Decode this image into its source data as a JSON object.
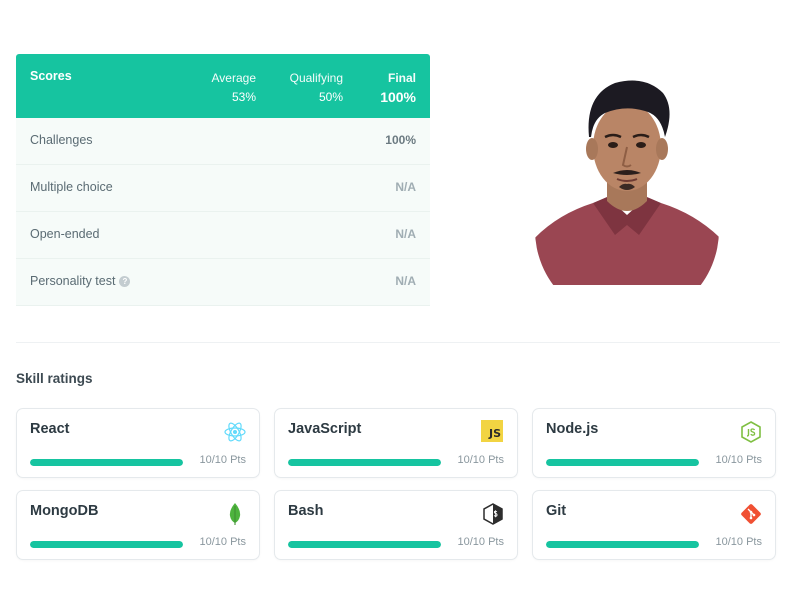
{
  "scores": {
    "title": "Scores",
    "columns": [
      {
        "label": "Average",
        "value": "53%"
      },
      {
        "label": "Qualifying",
        "value": "50%"
      },
      {
        "label": "Final",
        "value": "100%"
      }
    ],
    "rows": [
      {
        "name": "Challenges",
        "value": "100%"
      },
      {
        "name": "Multiple choice",
        "value": "N/A"
      },
      {
        "name": "Open-ended",
        "value": "N/A"
      },
      {
        "name": "Personality test",
        "value": "N/A"
      }
    ],
    "help_glyph": "?"
  },
  "skills": {
    "title": "Skill ratings",
    "items": [
      {
        "name": "React",
        "points": "10/10 Pts",
        "progress": 1.0,
        "icon": "react-icon"
      },
      {
        "name": "JavaScript",
        "points": "10/10 Pts",
        "progress": 1.0,
        "icon": "javascript-icon",
        "badge": "JS"
      },
      {
        "name": "Node.js",
        "points": "10/10 Pts",
        "progress": 1.0,
        "icon": "nodejs-icon"
      },
      {
        "name": "MongoDB",
        "points": "10/10 Pts",
        "progress": 1.0,
        "icon": "mongodb-icon"
      },
      {
        "name": "Bash",
        "points": "10/10 Pts",
        "progress": 1.0,
        "icon": "bash-icon"
      },
      {
        "name": "Git",
        "points": "10/10 Pts",
        "progress": 1.0,
        "icon": "git-icon"
      }
    ]
  },
  "colors": {
    "accent": "#16c4a0",
    "react": "#61dafb",
    "javascript": "#f2d442",
    "nodejs": "#7fbf42",
    "mongodb": "#4db33d",
    "git": "#f05033"
  }
}
